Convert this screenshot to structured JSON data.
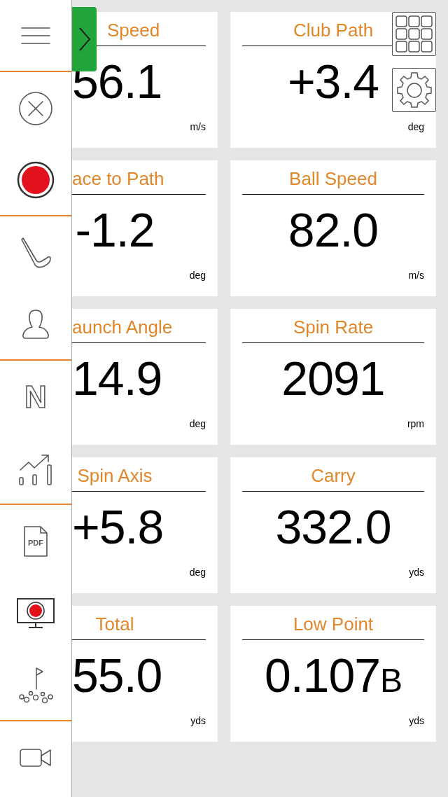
{
  "sidebar": {
    "items": [
      {
        "kind": "menu",
        "divider_after": true
      },
      {
        "kind": "close",
        "divider_after": false
      },
      {
        "kind": "record",
        "divider_after": true
      },
      {
        "kind": "club",
        "divider_after": false
      },
      {
        "kind": "person",
        "divider_after": true
      },
      {
        "kind": "letter",
        "label": "N",
        "divider_after": false
      },
      {
        "kind": "chart",
        "divider_after": true
      },
      {
        "kind": "pdf",
        "label": "PDF",
        "divider_after": false
      },
      {
        "kind": "screen-record",
        "divider_after": false
      },
      {
        "kind": "golf-target",
        "divider_after": true
      },
      {
        "kind": "video",
        "divider_after": false
      }
    ]
  },
  "cards": [
    {
      "title": "Speed",
      "value": "56.1",
      "unit": "m/s"
    },
    {
      "title": "Club Path",
      "value": "+3.4",
      "unit": "deg"
    },
    {
      "title": "ace to Path",
      "value": "-1.2",
      "unit": "deg"
    },
    {
      "title": "Ball Speed",
      "value": "82.0",
      "unit": "m/s"
    },
    {
      "title": "aunch Angle",
      "value": "14.9",
      "unit": "deg"
    },
    {
      "title": "Spin Rate",
      "value": "2091",
      "unit": "rpm"
    },
    {
      "title": "Spin Axis",
      "value": "+5.8",
      "unit": "deg"
    },
    {
      "title": "Carry",
      "value": "332.0",
      "unit": "yds"
    },
    {
      "title": "Total",
      "value": "55.0",
      "unit": "yds"
    },
    {
      "title": "Low Point",
      "value": "0.107",
      "suffix": "B",
      "unit": "yds"
    }
  ]
}
